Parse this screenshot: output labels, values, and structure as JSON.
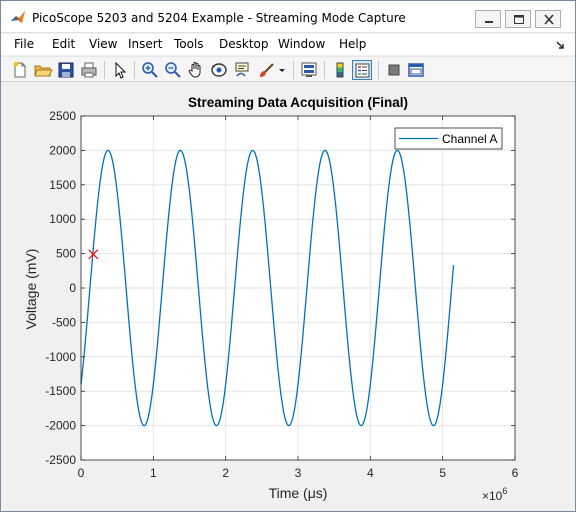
{
  "window": {
    "title": "PicoScope 5203 and 5204 Example - Streaming Mode Capture",
    "app_icon": "matlab-icon"
  },
  "menu": {
    "items": [
      "File",
      "Edit",
      "View",
      "Insert",
      "Tools",
      "Desktop",
      "Window",
      "Help"
    ]
  },
  "toolbar": {
    "buttons": [
      "new-figure-icon",
      "open-file-icon",
      "save-icon",
      "print-icon",
      "edit-plot-icon",
      "zoom-in-icon",
      "zoom-out-icon",
      "pan-icon",
      "rotate-3d-icon",
      "data-cursor-icon",
      "brush-icon",
      "link-plot-icon",
      "colorbar-icon",
      "legend-icon",
      "hide-plot-tools-icon",
      "show-plot-tools-icon"
    ]
  },
  "colors": {
    "series": "#0072bd",
    "marker": "#ff0000",
    "axes_bg": "#ffffff",
    "figure_bg": "#f0f0f0",
    "grid": "#e6e6e6"
  },
  "chart_data": {
    "type": "line",
    "title": "Streaming Data Acquisition (Final)",
    "xlabel": "Time (μs)",
    "ylabel": "Voltage (mV)",
    "x_exponent_label": "×10",
    "x_exponent": "6",
    "xlim": [
      0,
      6
    ],
    "ylim": [
      -2500,
      2500
    ],
    "xticks": [
      "0",
      "1",
      "2",
      "3",
      "4",
      "5",
      "6"
    ],
    "yticks": [
      "2500",
      "2000",
      "1500",
      "1000",
      "500",
      "0",
      "-500",
      "-1000",
      "-1500",
      "-2000",
      "-2500"
    ],
    "grid": true,
    "legend": {
      "placement": "top-right",
      "entries": [
        "Channel A"
      ]
    },
    "series": [
      {
        "name": "Channel A",
        "waveform": "sine",
        "amplitude": 2000,
        "period": 1.0,
        "x_start": 0,
        "x_end": 5.15,
        "y_start": -1400,
        "peaks": [
          [
            0.37,
            2000
          ],
          [
            1.37,
            2000
          ],
          [
            2.37,
            2000
          ],
          [
            3.37,
            2000
          ],
          [
            4.37,
            2000
          ]
        ],
        "troughs": [
          [
            0.87,
            -2000
          ],
          [
            1.87,
            -2000
          ],
          [
            2.87,
            -2000
          ],
          [
            3.87,
            -2000
          ],
          [
            4.87,
            -2000
          ]
        ],
        "y_end": 300
      }
    ],
    "marker": {
      "type": "x",
      "x": 0.17,
      "y": 490
    }
  }
}
